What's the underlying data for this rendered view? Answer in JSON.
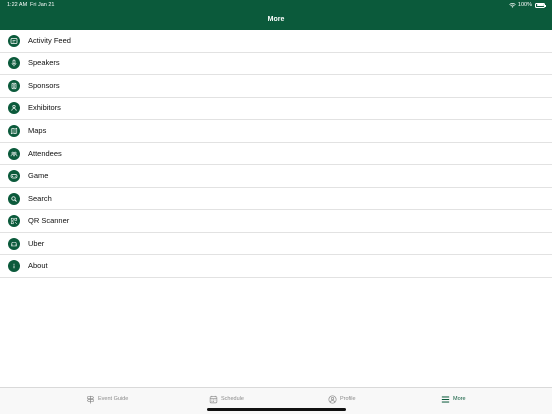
{
  "status_bar": {
    "time": "1:22 AM",
    "date": "Fri Jan 21",
    "battery_label": "100%",
    "battery_level": 1.0
  },
  "header": {
    "title": "More",
    "background_color": "#0b5a3b"
  },
  "menu": {
    "items": [
      {
        "label": "Activity Feed",
        "icon": "activity-feed-icon"
      },
      {
        "label": "Speakers",
        "icon": "microphone-icon"
      },
      {
        "label": "Sponsors",
        "icon": "sponsor-badge-icon"
      },
      {
        "label": "Exhibitors",
        "icon": "exhibitor-icon"
      },
      {
        "label": "Maps",
        "icon": "map-icon"
      },
      {
        "label": "Attendees",
        "icon": "attendees-icon"
      },
      {
        "label": "Game",
        "icon": "game-controller-icon"
      },
      {
        "label": "Search",
        "icon": "search-icon"
      },
      {
        "label": "QR Scanner",
        "icon": "qr-code-icon"
      },
      {
        "label": "Uber",
        "icon": "car-icon"
      },
      {
        "label": "About",
        "icon": "info-icon"
      }
    ]
  },
  "tab_bar": {
    "tabs": [
      {
        "label": "Event Guide",
        "icon": "signpost-icon",
        "active": false
      },
      {
        "label": "Schedule",
        "icon": "calendar-icon",
        "active": false
      },
      {
        "label": "Profile",
        "icon": "profile-icon",
        "active": false
      },
      {
        "label": "More",
        "icon": "menu-lines-icon",
        "active": true
      }
    ],
    "active_color": "#0b5a3b",
    "inactive_color": "#8a8a8a"
  }
}
